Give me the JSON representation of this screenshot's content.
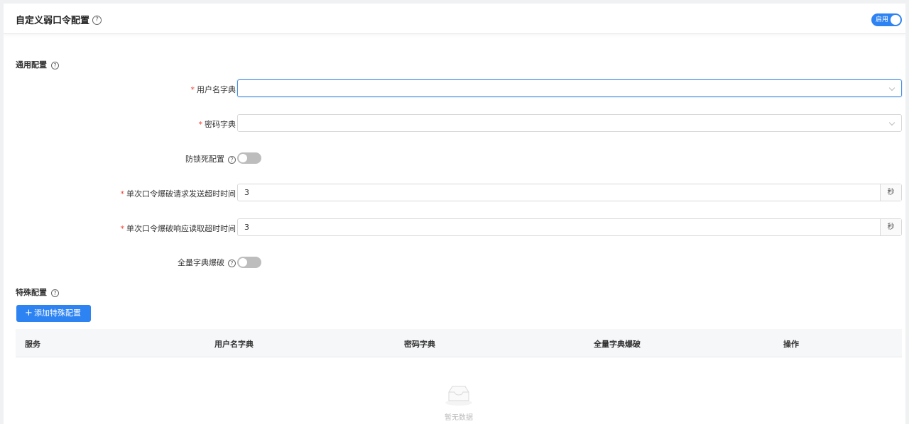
{
  "header": {
    "title": "自定义弱口令配置",
    "switch_label": "启用",
    "switch_on": true
  },
  "general": {
    "title": "通用配置",
    "username_dict": {
      "label": "用户名字典",
      "value": ""
    },
    "password_dict": {
      "label": "密码字典",
      "value": ""
    },
    "anti_lock": {
      "label": "防锁死配置",
      "on": false
    },
    "request_timeout": {
      "label": "单次口令爆破请求发送超时时间",
      "value": "3",
      "unit": "秒"
    },
    "response_timeout": {
      "label": "单次口令爆破响应读取超时时间",
      "value": "3",
      "unit": "秒"
    },
    "full_dict": {
      "label": "全量字典爆破",
      "on": false
    }
  },
  "special": {
    "title": "特殊配置",
    "add_button": "添加特殊配置",
    "columns": [
      "服务",
      "用户名字典",
      "密码字典",
      "全量字典爆破",
      "操作"
    ],
    "rows": [],
    "empty_text": "暂无数据"
  },
  "colors": {
    "primary": "#2e83f2",
    "required": "#f04134",
    "toggle_off": "#bdbdbd"
  }
}
